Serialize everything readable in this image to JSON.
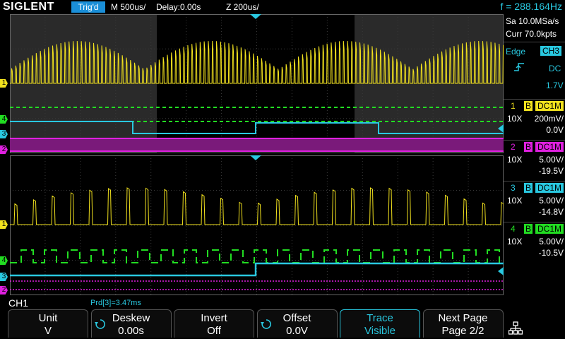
{
  "top": {
    "brand": "SIGLENT",
    "trigger_status": "Trig'd",
    "timebase": "M 500us/",
    "delay": "Delay:0.00s",
    "zoom": "Z 200us/",
    "frequency": "f = 288.164Hz"
  },
  "acq": {
    "sample_rate": "Sa 10.0MSa/s",
    "memory": "Curr 70.0kpts"
  },
  "trigger": {
    "type": "Edge",
    "source": "CH3",
    "coupling": "DC",
    "level": "1.7V"
  },
  "channels": [
    {
      "num": "1",
      "b": "B",
      "coupling": "DC1M",
      "probe": "10X",
      "scale": "200mV/",
      "offset": "0.0V",
      "color": "#f2e21e"
    },
    {
      "num": "2",
      "b": "B",
      "coupling": "DC1M",
      "probe": "10X",
      "scale": "5.00V/",
      "offset": "-19.5V",
      "color": "#e020e0"
    },
    {
      "num": "3",
      "b": "B",
      "coupling": "DC1M",
      "probe": "10X",
      "scale": "5.00V/",
      "offset": "-14.8V",
      "color": "#29c8e0"
    },
    {
      "num": "4",
      "b": "B",
      "coupling": "DC1M",
      "probe": "10X",
      "scale": "5.00V/",
      "offset": "-10.5V",
      "color": "#22dd22"
    }
  ],
  "markers": {
    "ch1": "1",
    "ch2": "2",
    "ch3": "3",
    "ch4": "4"
  },
  "status": {
    "active_channel": "CH1",
    "measurement": "Prd[3]=3.47ms"
  },
  "softkeys": [
    {
      "label": "Unit",
      "value": "V",
      "knob": false,
      "active": false
    },
    {
      "label": "Deskew",
      "value": "0.00s",
      "knob": true,
      "active": false
    },
    {
      "label": "Invert",
      "value": "Off",
      "knob": false,
      "active": false
    },
    {
      "label": "Offset",
      "value": "0.0V",
      "knob": true,
      "active": false
    },
    {
      "label": "Trace",
      "value": "Visible",
      "knob": false,
      "active": true
    },
    {
      "label": "Next Page",
      "value": "Page 2/2",
      "knob": false,
      "active": false
    }
  ],
  "icons": {
    "trigger_edge": "rising-edge-icon",
    "knob": "adjust-knob-icon",
    "network": "network-icon"
  }
}
